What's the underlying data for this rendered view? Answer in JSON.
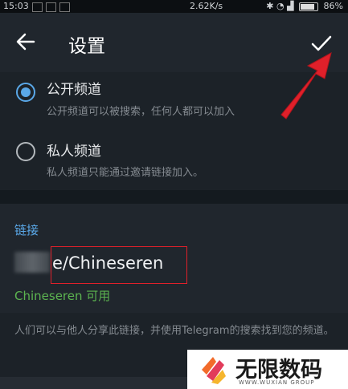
{
  "status_bar": {
    "time": "15:03",
    "network_speed": "2.62K/s",
    "battery": "86%",
    "battery_level": 0.86
  },
  "appbar": {
    "title": "设置"
  },
  "options": [
    {
      "title": "公开频道",
      "description": "公开频道可以被搜索，任何人都可以加入",
      "selected": true
    },
    {
      "title": "私人频道",
      "description": "私人频道只能通过邀请链接加入。",
      "selected": false
    }
  ],
  "link_section": {
    "title": "链接",
    "link_value": "e/Chineseren",
    "availability": "Chineseren 可用"
  },
  "info_text": "人们可以与他人分享此链接，并使用Telegram的搜索找到您的频道。",
  "watermark": {
    "text": "无限数码",
    "subtext": "WWW.WUXIAN GROUP"
  },
  "colors": {
    "accent": "#5aa8e8",
    "available": "#5cb450",
    "annotation": "#e0202a"
  }
}
